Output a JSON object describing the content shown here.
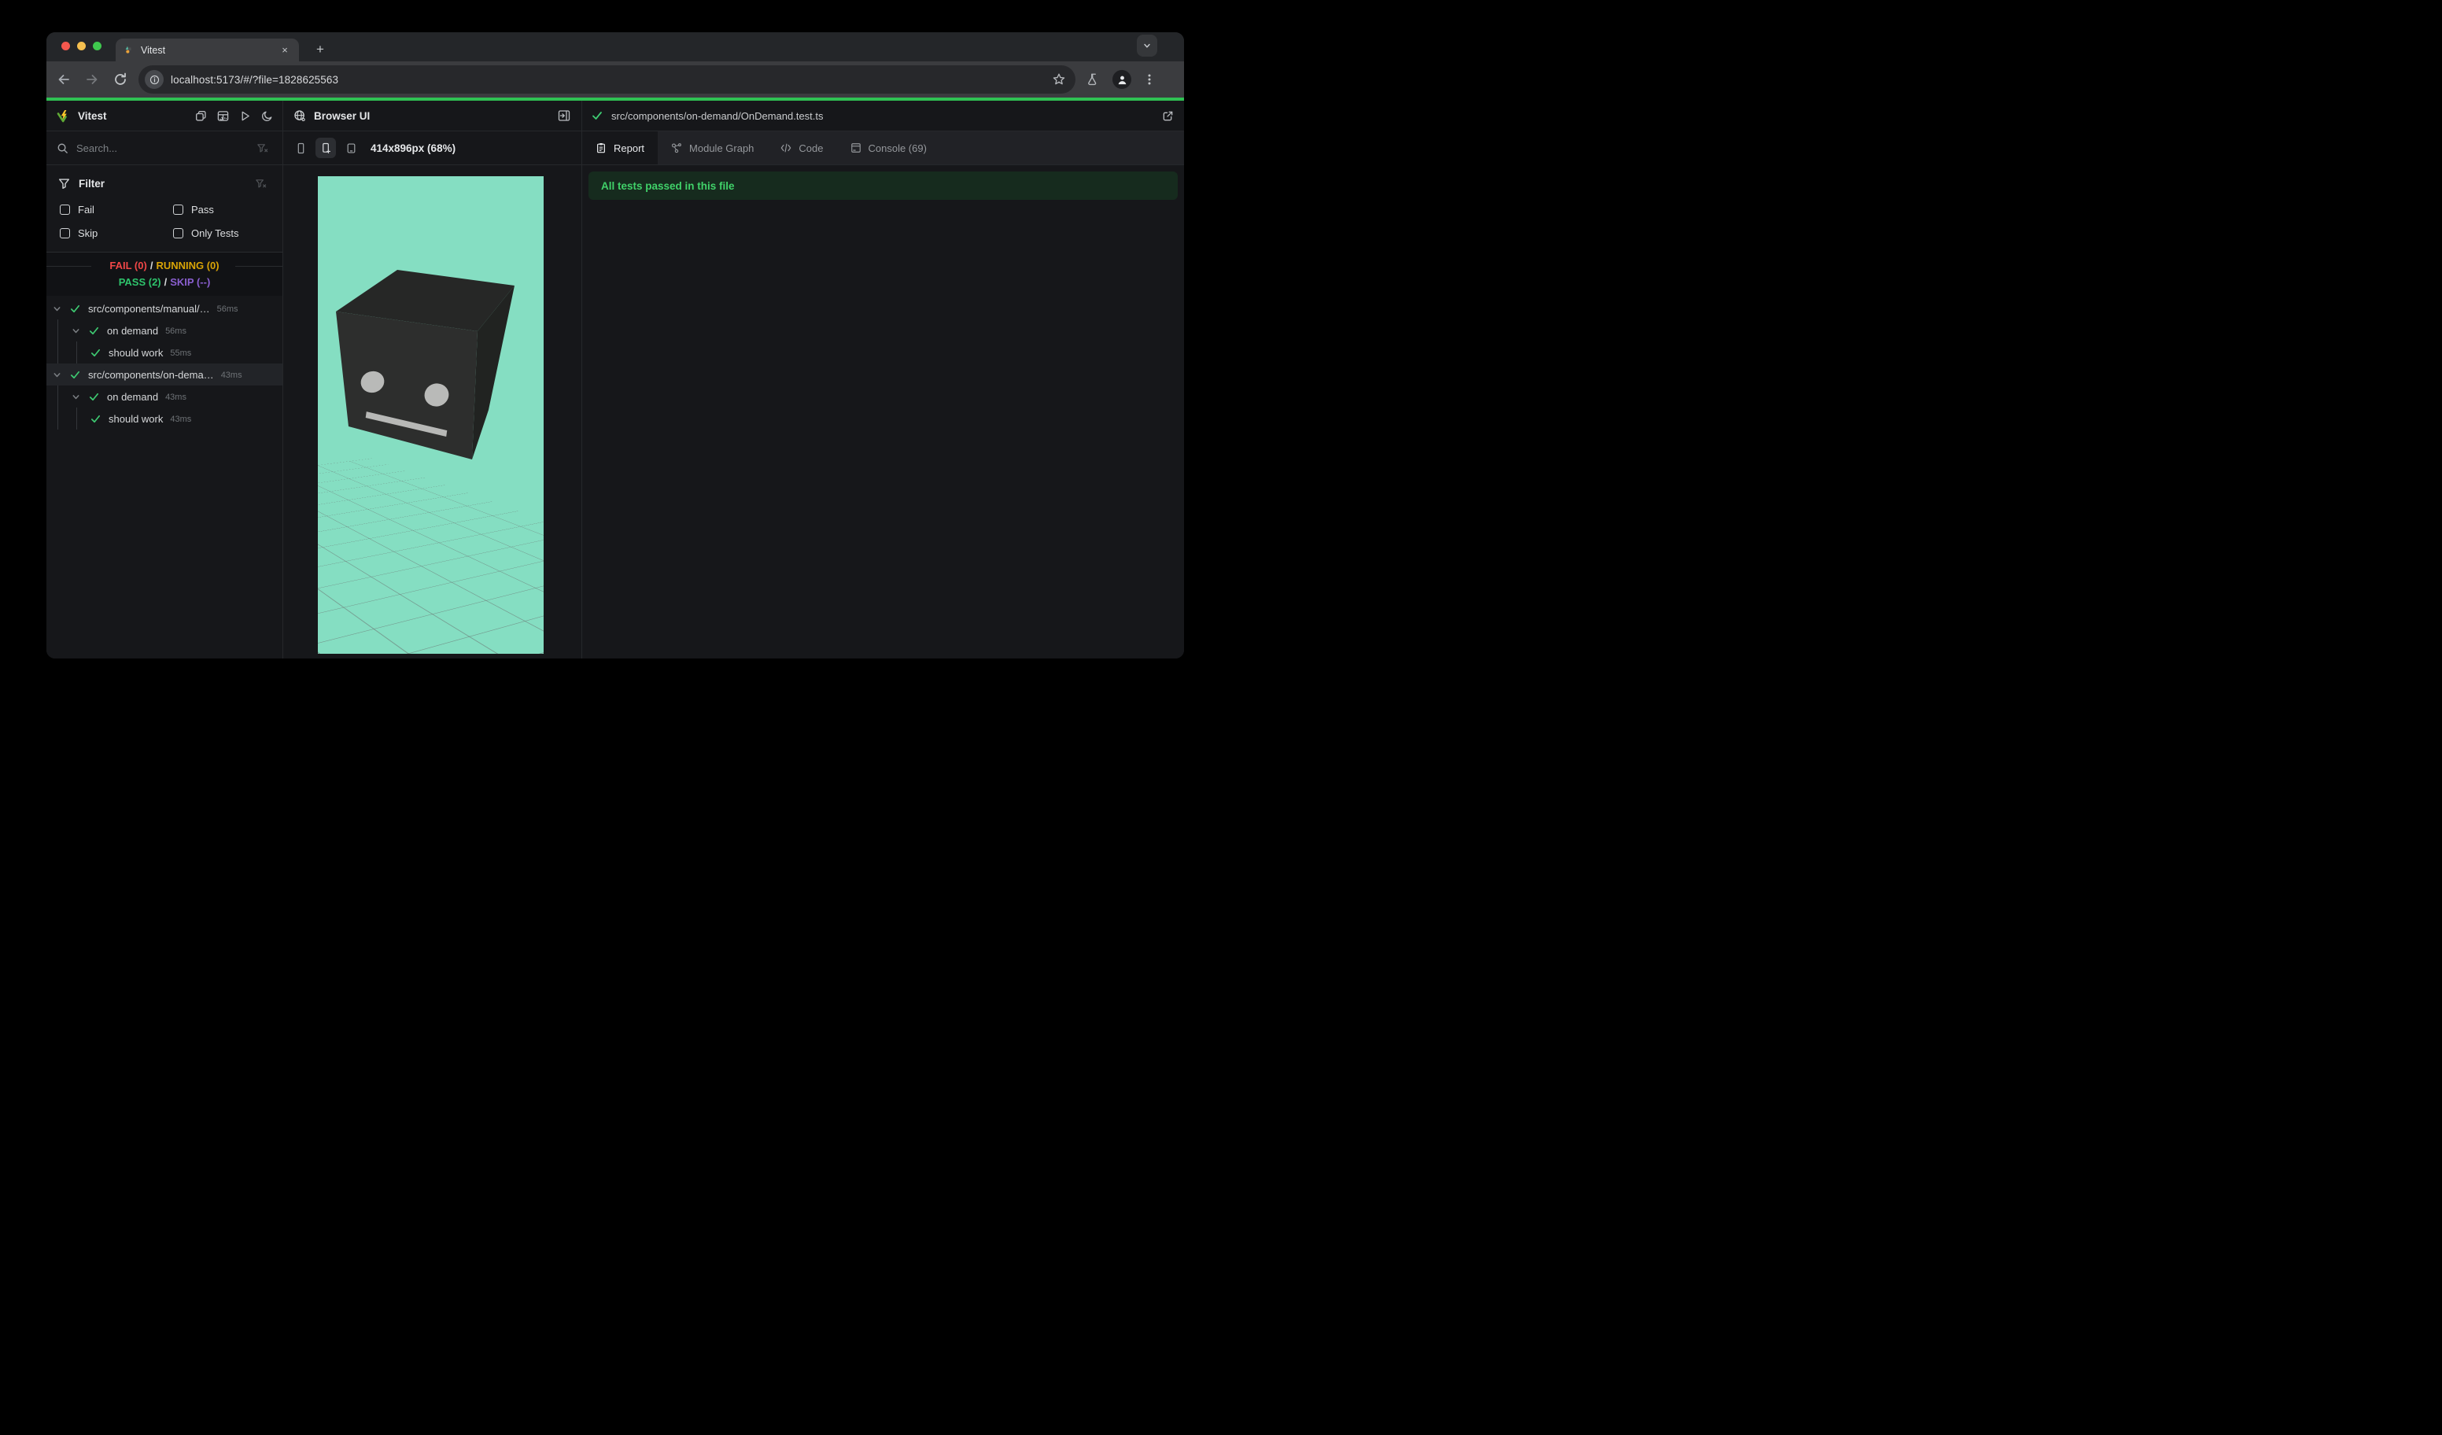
{
  "browser": {
    "tab_title": "Vitest",
    "close_glyph": "×",
    "new_tab_glyph": "+",
    "url": "localhost:5173/#/?file=1828625563"
  },
  "sidebar": {
    "title": "Vitest",
    "search_placeholder": "Search...",
    "filter": {
      "title": "Filter",
      "options": [
        {
          "label": "Fail",
          "checked": false
        },
        {
          "label": "Pass",
          "checked": false
        },
        {
          "label": "Skip",
          "checked": false
        },
        {
          "label": "Only Tests",
          "checked": false
        }
      ]
    },
    "status": {
      "fail": "FAIL (0)",
      "sep1": "/",
      "running": "RUNNING (0)",
      "pass": "PASS (2)",
      "sep2": "/",
      "skip": "SKIP (--)"
    },
    "tree": [
      {
        "label": "src/components/manual/…",
        "time": "56ms",
        "level": 1,
        "state": "pass"
      },
      {
        "label": "on demand",
        "time": "56ms",
        "level": 2,
        "state": "pass"
      },
      {
        "label": "should work",
        "time": "55ms",
        "level": 3,
        "state": "pass"
      },
      {
        "label": "src/components/on-dema…",
        "time": "43ms",
        "level": 1,
        "state": "pass",
        "selected": true
      },
      {
        "label": "on demand",
        "time": "43ms",
        "level": 2,
        "state": "pass"
      },
      {
        "label": "should work",
        "time": "43ms",
        "level": 3,
        "state": "pass"
      }
    ]
  },
  "browser_ui": {
    "title": "Browser UI",
    "viewport_label": "414x896px (68%)"
  },
  "report": {
    "file_path": "src/components/on-demand/OnDemand.test.ts",
    "tabs": [
      {
        "label": "Report",
        "active": true
      },
      {
        "label": "Module Graph",
        "active": false
      },
      {
        "label": "Code",
        "active": false
      },
      {
        "label": "Console (69)",
        "active": false
      }
    ],
    "banner": "All tests passed in this file"
  },
  "colors": {
    "progress_green": "#2fc153",
    "pass_green": "#3ecb72",
    "fail_red": "#f04747",
    "running_yellow": "#d9a406",
    "skip_purple": "#8a5fd0",
    "banner_bg": "#162b1e",
    "viewport_bg": "#85dec2",
    "cube_top": "#262726",
    "cube_front": "#2d2e2d",
    "cube_right": "#212321"
  }
}
